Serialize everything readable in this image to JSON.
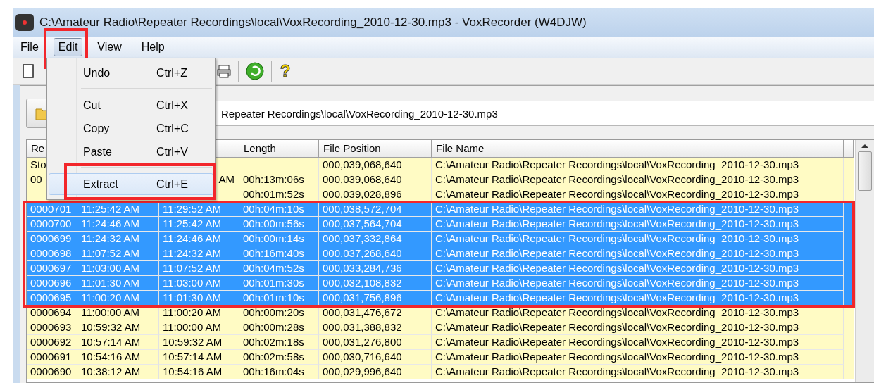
{
  "window": {
    "title": "C:\\Amateur Radio\\Repeater Recordings\\local\\VoxRecording_2010-12-30.mp3 - VoxRecorder (W4DJW)"
  },
  "menu_bar": [
    {
      "label": "File",
      "open": false,
      "marked": false
    },
    {
      "label": "Edit",
      "open": true,
      "marked": true
    },
    {
      "label": "View",
      "open": false,
      "marked": false
    },
    {
      "label": "Help",
      "open": false,
      "marked": false
    }
  ],
  "toolbar": {
    "help_glyph": "?"
  },
  "edit_menu": [
    {
      "kind": "item",
      "label": "Undo",
      "shortcut": "Ctrl+Z",
      "selected": false,
      "marked": false
    },
    {
      "kind": "separator"
    },
    {
      "kind": "item",
      "label": "Cut",
      "shortcut": "Ctrl+X",
      "selected": false,
      "marked": false
    },
    {
      "kind": "item",
      "label": "Copy",
      "shortcut": "Ctrl+C",
      "selected": false,
      "marked": false
    },
    {
      "kind": "item",
      "label": "Paste",
      "shortcut": "Ctrl+V",
      "selected": false,
      "marked": false
    },
    {
      "kind": "separator"
    },
    {
      "kind": "item",
      "label": "Extract",
      "shortcut": "Ctrl+E",
      "selected": true,
      "marked": true
    }
  ],
  "path_field": {
    "value": "Repeater Recordings\\local\\VoxRecording_2010-12-30.mp3"
  },
  "table": {
    "columns": [
      "Re",
      "",
      "",
      "Length",
      "File Position",
      "File Name"
    ],
    "selection_marked": true,
    "rows": [
      {
        "cells": [
          "Sto",
          "",
          "",
          "",
          "000,039,068,640",
          "C:\\Amateur Radio\\Repeater Recordings\\local\\VoxRecording_2010-12-30.mp3"
        ],
        "selected": false
      },
      {
        "cells": [
          "00",
          "",
          "AM",
          "00h:13m:06s",
          "000,039,068,640",
          "C:\\Amateur Radio\\Repeater Recordings\\local\\VoxRecording_2010-12-30.mp3"
        ],
        "selected": false,
        "covered": true
      },
      {
        "cells": [
          "",
          "",
          "",
          "00h:01m:52s",
          "000,039,028,896",
          "C:\\Amateur Radio\\Repeater Recordings\\local\\VoxRecording_2010-12-30.mp3"
        ],
        "selected": false
      },
      {
        "cells": [
          "0000701",
          "11:25:42 AM",
          "11:29:52 AM",
          "00h:04m:10s",
          "000,038,572,704",
          "C:\\Amateur Radio\\Repeater Recordings\\local\\VoxRecording_2010-12-30.mp3"
        ],
        "selected": true,
        "covered": false
      },
      {
        "cells": [
          "0000700",
          "11:24:46 AM",
          "11:25:42 AM",
          "00h:00m:56s",
          "000,037,564,704",
          "C:\\Amateur Radio\\Repeater Recordings\\local\\VoxRecording_2010-12-30.mp3"
        ],
        "selected": true,
        "covered": false
      },
      {
        "cells": [
          "0000699",
          "11:24:32 AM",
          "11:24:46 AM",
          "00h:00m:14s",
          "000,037,332,864",
          "C:\\Amateur Radio\\Repeater Recordings\\local\\VoxRecording_2010-12-30.mp3"
        ],
        "selected": true,
        "covered": false
      },
      {
        "cells": [
          "0000698",
          "11:07:52 AM",
          "11:24:32 AM",
          "00h:16m:40s",
          "000,037,268,640",
          "C:\\Amateur Radio\\Repeater Recordings\\local\\VoxRecording_2010-12-30.mp3"
        ],
        "selected": true,
        "covered": false
      },
      {
        "cells": [
          "0000697",
          "11:03:00 AM",
          "11:07:52 AM",
          "00h:04m:52s",
          "000,033,284,736",
          "C:\\Amateur Radio\\Repeater Recordings\\local\\VoxRecording_2010-12-30.mp3"
        ],
        "selected": true,
        "covered": false
      },
      {
        "cells": [
          "0000696",
          "11:01:30 AM",
          "11:03:00 AM",
          "00h:01m:30s",
          "000,032,108,832",
          "C:\\Amateur Radio\\Repeater Recordings\\local\\VoxRecording_2010-12-30.mp3"
        ],
        "selected": true,
        "covered": false
      },
      {
        "cells": [
          "0000695",
          "11:00:20 AM",
          "11:01:30 AM",
          "00h:01m:10s",
          "000,031,756,896",
          "C:\\Amateur Radio\\Repeater Recordings\\local\\VoxRecording_2010-12-30.mp3"
        ],
        "selected": true,
        "covered": false
      },
      {
        "cells": [
          "0000694",
          "11:00:00 AM",
          "11:00:20 AM",
          "00h:00m:20s",
          "000,031,476,672",
          "C:\\Amateur Radio\\Repeater Recordings\\local\\VoxRecording_2010-12-30.mp3"
        ],
        "selected": false,
        "covered": false
      },
      {
        "cells": [
          "0000693",
          "10:59:32 AM",
          "11:00:00 AM",
          "00h:00m:28s",
          "000,031,388,832",
          "C:\\Amateur Radio\\Repeater Recordings\\local\\VoxRecording_2010-12-30.mp3"
        ],
        "selected": false,
        "covered": false
      },
      {
        "cells": [
          "0000692",
          "10:57:14 AM",
          "10:59:32 AM",
          "00h:02m:18s",
          "000,031,276,800",
          "C:\\Amateur Radio\\Repeater Recordings\\local\\VoxRecording_2010-12-30.mp3"
        ],
        "selected": false,
        "covered": false
      },
      {
        "cells": [
          "0000691",
          "10:54:16 AM",
          "10:57:14 AM",
          "00h:02m:58s",
          "000,030,716,640",
          "C:\\Amateur Radio\\Repeater Recordings\\local\\VoxRecording_2010-12-30.mp3"
        ],
        "selected": false,
        "covered": false
      },
      {
        "cells": [
          "0000690",
          "10:38:12 AM",
          "10:54:16 AM",
          "00h:16m:04s",
          "000,029,996,640",
          "C:\\Amateur Radio\\Repeater Recordings\\local\\VoxRecording_2010-12-30.mp3"
        ],
        "selected": false,
        "covered": false
      }
    ]
  }
}
